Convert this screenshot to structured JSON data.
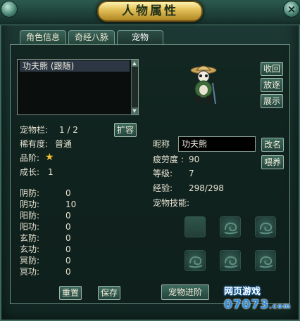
{
  "window": {
    "title": "人物属性"
  },
  "tabs": [
    {
      "label": "角色信息",
      "active": false
    },
    {
      "label": "奇经八脉",
      "active": false
    },
    {
      "label": "宠物",
      "active": true
    }
  ],
  "pet_list": {
    "items": [
      "功夫熊 (跟随)"
    ]
  },
  "pet_actions": {
    "recall": "收回",
    "release": "放逐",
    "show": "展示"
  },
  "pet_slots": {
    "label": "宠物栏:",
    "value": "1 / 2",
    "expand_button": "扩容"
  },
  "rarity": {
    "label": "稀有度:",
    "value": "普通"
  },
  "grade": {
    "label": "品阶:",
    "stars": 1
  },
  "growth": {
    "label": "成长:",
    "value": "1"
  },
  "stats": [
    {
      "label": "阴防:",
      "value": "0"
    },
    {
      "label": "阴功:",
      "value": "10"
    },
    {
      "label": "阳防:",
      "value": "0"
    },
    {
      "label": "阳功:",
      "value": "0"
    },
    {
      "label": "玄防:",
      "value": "0"
    },
    {
      "label": "玄功:",
      "value": "0"
    },
    {
      "label": "冥防:",
      "value": "0"
    },
    {
      "label": "冥功:",
      "value": "0"
    }
  ],
  "nickname": {
    "label": "昵称",
    "value": "功夫熊",
    "rename_button": "改名"
  },
  "fatigue": {
    "label": "疲劳度",
    "value": "90",
    "feed_button": "喂养"
  },
  "level": {
    "label": "等级:",
    "value": "7"
  },
  "experience": {
    "label": "经验:",
    "value": "298/298"
  },
  "skills": {
    "label": "宠物技能:"
  },
  "bottom_buttons": {
    "reset": "重置",
    "save": "保存",
    "advance": "宠物进阶"
  },
  "watermark": {
    "top": "网页游戏",
    "bottom": "07073",
    "suffix": ".com"
  },
  "colors": {
    "accent_gold": "#e4c25a",
    "panel_green": "#1b332d",
    "star_yellow": "#f2c230"
  }
}
